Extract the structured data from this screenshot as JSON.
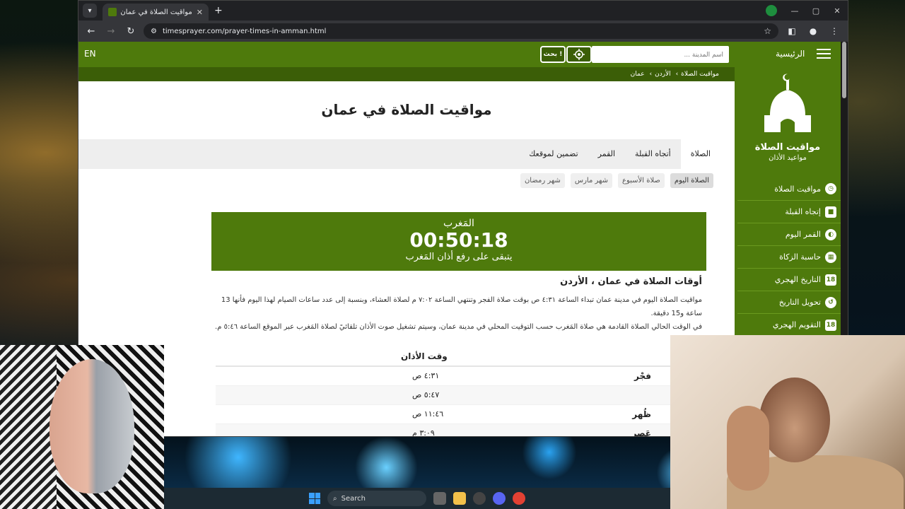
{
  "browser": {
    "tab_title": "مواقيت الصلاة في عمان",
    "url": "timesprayer.com/prayer-times-in-amman.html"
  },
  "nav": {
    "lang": "EN",
    "search_placeholder": "أسم المدينة ...",
    "search_button": "بحث !",
    "home": "الرئيسية"
  },
  "breadcrumb": [
    "مواقيت الصلاة",
    "الأردن",
    "عمان"
  ],
  "sidebar": {
    "logo_title": "مواقيت الصلاة",
    "logo_subtitle": "مواعيد الأذان",
    "items": [
      {
        "label": "مواقيت الصلاة",
        "icon": "clock-icon"
      },
      {
        "label": "إتجاه القبلة",
        "icon": "kaaba-icon"
      },
      {
        "label": "القمر اليوم",
        "icon": "moon-icon"
      },
      {
        "label": "حاسبة الزكاة",
        "icon": "calculator-icon"
      },
      {
        "label": "التاريخ الهجري",
        "icon": "calendar-icon"
      },
      {
        "label": "تحويل التاريخ",
        "icon": "history-icon"
      },
      {
        "label": "التقويم الهجري",
        "icon": "calendar-icon"
      }
    ]
  },
  "page": {
    "title": "مواقيت الصلاة في عمان",
    "tabs": [
      "الصلاة",
      "أتجاه القبلة",
      "القمر",
      "تضمين لموقعك"
    ],
    "subtabs": [
      "الصلاة اليوم",
      "صلاة الأسبوع",
      "شهر مارس",
      "شهر رمضان"
    ]
  },
  "countdown": {
    "prayer": "المَغرب",
    "time": "00:50:18",
    "remaining_text": "يتبقى على رفع أذان المَغرب"
  },
  "section": {
    "title": "أوقات الصلاة في عمان ، الأردن",
    "p1": "مواقيت الصلاة اليوم في مدينة عمان تبداء الساعة ٤:٣١ ص بوقت صلاة الفجر وتنتهي الساعة ٧:٠٢ م لصلاة العشاء، وبنسبة إلى عدد ساعات الصيام لهذا اليوم فأنها 13 ساعة و15 دقيقة.",
    "p2": "في الوقت الحالي الصلاة القادمة هي صلاة المَغرب حسب التوقيت المحلي في مدينة عمان، وسيتم تشغيل صوت الأذان تلقائيً لصلاة المَغرب عبر الموقع الساعة ٥:٤٦ م."
  },
  "table": {
    "header": "وقت الأذان",
    "rows": [
      {
        "name": "فجْر",
        "time": "٤:٣١ ص"
      },
      {
        "name": "",
        "time": "٥:٤٧ ص"
      },
      {
        "name": "ظُهر",
        "time": "١١:٤٦ ص"
      },
      {
        "name": "عَصر",
        "time": "٣:٠٩ م"
      }
    ]
  },
  "taskbar": {
    "search_label": "Search"
  },
  "colors": {
    "brand_green": "#4e7a0c",
    "dark_green": "#3b5e07"
  }
}
